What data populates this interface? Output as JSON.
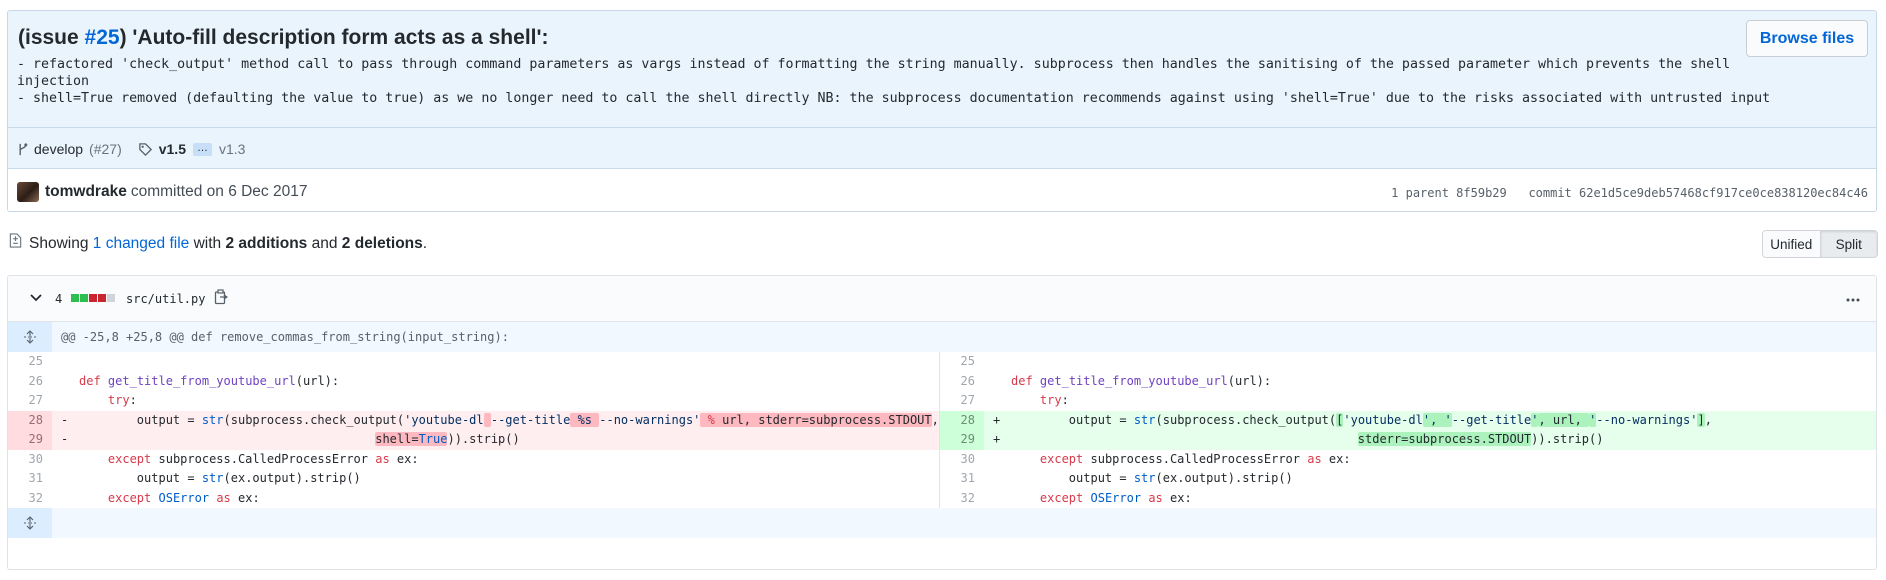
{
  "commit": {
    "title_prefix": "(issue ",
    "issue_link": "#25",
    "title_suffix": ") 'Auto-fill description form acts as a shell':",
    "browse_files_label": "Browse files",
    "description_lines": [
      "- refactored 'check_output' method call to pass through command parameters as vargs instead of formatting the string manually. subprocess then handles the sanitising of the passed parameter which prevents the shell",
      "injection",
      "- shell=True removed (defaulting the value to true) as we no longer need to call the shell directly NB: the subprocess documentation recommends against using 'shell=True' due to the risks associated with untrusted input"
    ],
    "branch": "develop",
    "branch_pr": "(#27)",
    "tag_new": "v1.5",
    "tag_ellipsis": "…",
    "tag_old": "v1.3",
    "author": "tomwdrake",
    "committed_text": "committed on 6 Dec 2017",
    "parent_text": "1 parent 8f59b29",
    "commit_text": "commit 62e1d5ce9deb57468cf917ce0ce838120ec84c46"
  },
  "summary": {
    "showing": "Showing ",
    "changed_files": "1 changed file",
    "with": " with ",
    "additions": "2 additions",
    "and": " and ",
    "deletions": "2 deletions",
    "period": "."
  },
  "view_toggle": {
    "unified": "Unified",
    "split": "Split",
    "selected": "split"
  },
  "file": {
    "change_count": "4",
    "path": "src/util.py",
    "hunk_header": "@@ -25,8 +25,8 @@ def remove_commas_from_string(input_string):",
    "left_lines": [
      "25",
      "26",
      "27",
      "28",
      "29",
      "30",
      "31",
      "32"
    ],
    "right_lines": [
      "25",
      "26",
      "27",
      "28",
      "29",
      "30",
      "31",
      "32"
    ],
    "markers": {
      "deletion": "-",
      "addition": "+"
    }
  },
  "colors": {
    "link": "#0366d6",
    "diffstat_added": "#2cbe4e",
    "diffstat_deleted": "#cb2431",
    "deletion_bg": "#ffeef0",
    "addition_bg": "#e6ffed"
  },
  "icons": {
    "branch": "git-branch-icon",
    "tag": "tag-icon",
    "diff_summary": "file-diff-icon",
    "chevron": "chevron-down-icon",
    "copy": "clippy-icon",
    "kebab": "kebab-horizontal-icon",
    "expand": "unfold-icon"
  }
}
